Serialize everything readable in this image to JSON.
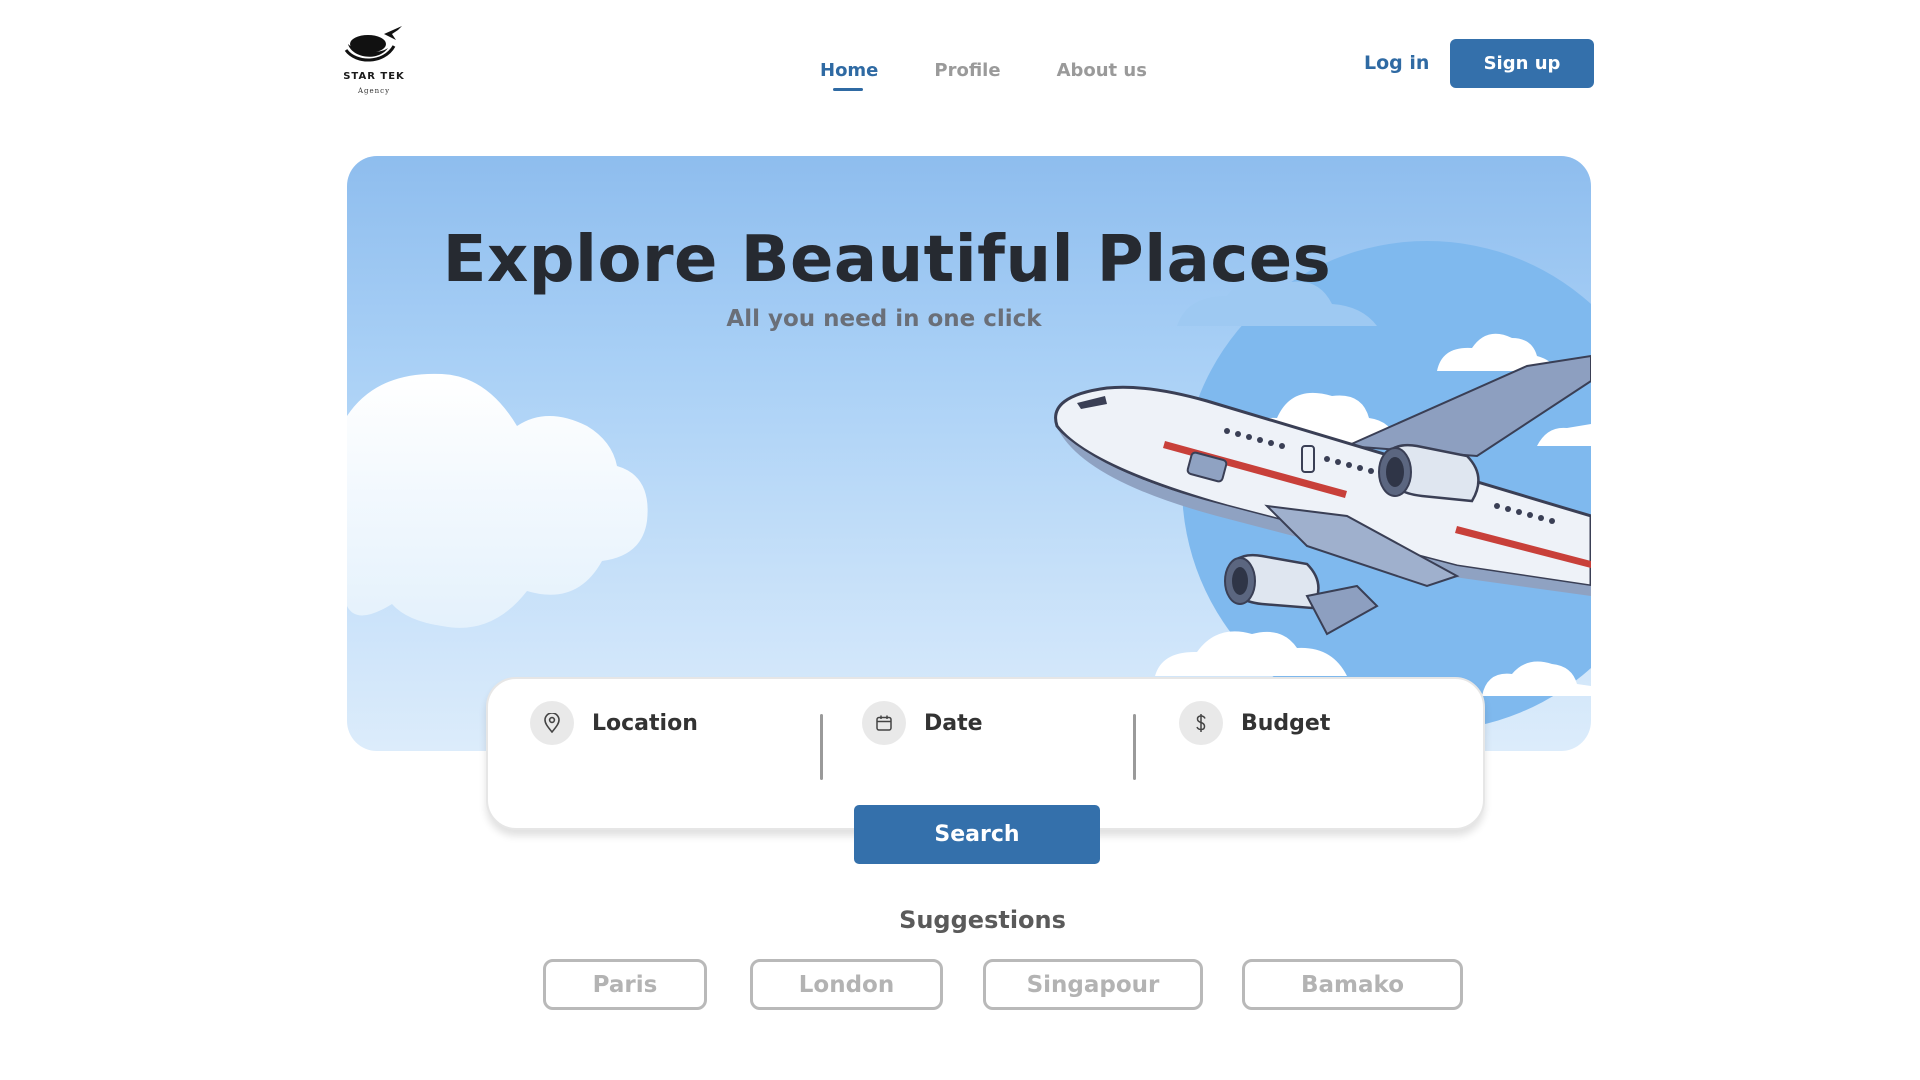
{
  "brand": {
    "name": "STAR TEK",
    "tagline": "Agency"
  },
  "nav": {
    "items": [
      {
        "label": "Home",
        "active": true
      },
      {
        "label": "Profile",
        "active": false
      },
      {
        "label": "About us",
        "active": false
      }
    ]
  },
  "auth": {
    "login_label": "Log in",
    "signup_label": "Sign up"
  },
  "hero": {
    "title": "Explore Beautiful Places",
    "subtitle": "All you need in one click"
  },
  "search": {
    "fields": [
      {
        "label": "Location",
        "icon": "location-pin-icon"
      },
      {
        "label": "Date",
        "icon": "calendar-icon"
      },
      {
        "label": "Budget",
        "icon": "dollar-icon"
      }
    ],
    "button_label": "Search"
  },
  "suggestions": {
    "title": "Suggestions",
    "items": [
      "Paris",
      "London",
      "Singapour",
      "Bamako"
    ]
  },
  "colors": {
    "primary": "#3470ab",
    "nav_active": "#2f6aa3",
    "nav_inactive": "#9a9a9a",
    "chip_border": "#b9b9b9"
  }
}
